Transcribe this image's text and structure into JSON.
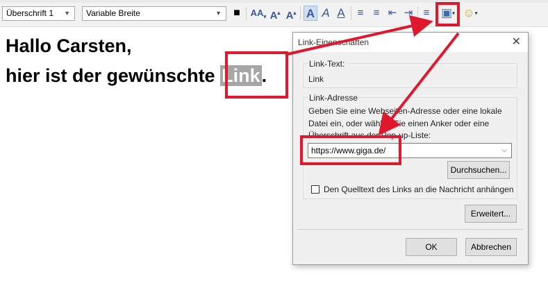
{
  "toolbar": {
    "paragraph_style": "Überschrift 1",
    "font": "Variable Breite",
    "text_color_glyph": "■",
    "smaller_text": "AA",
    "bigger_text": "A",
    "bold_text": "A",
    "italic_text": "A",
    "underline_text": "A",
    "bullets_glyph": "≡",
    "numbering_glyph": "≡",
    "outdent_glyph": "⇤",
    "indent_glyph": "⇥",
    "align_glyph": "≡",
    "insert_glyph": "▣",
    "smiley_glyph": "☺",
    "dropdown_glyph": "▾",
    "accent_color": "#3b6db5"
  },
  "document": {
    "line1": "Hallo Carsten,",
    "line2_prefix": "hier ist der gewünschte ",
    "link_word": "Link",
    "line2_suffix": "."
  },
  "dialog": {
    "title": "Link-Eigenschaften",
    "close_glyph": "✕",
    "link_text_label": "Link-Text:",
    "link_text_value": "Link",
    "link_address_label": "Link-Adresse",
    "help_line1": "Geben Sie eine Webseiten-Adresse oder eine lokale",
    "help_line2": "Datei ein, oder wählen Sie einen Anker oder eine",
    "help_line3": "Überschrift aus der Pop-up-Liste:",
    "url_value": "https://www.giga.de/",
    "browse_button": "Durchsuchen...",
    "attach_source_label": "Den Quelltext des Links an die Nachricht anhängen",
    "attach_source_checked": false,
    "advanced_button": "Erweitert...",
    "ok_button": "OK",
    "cancel_button": "Abbrechen"
  },
  "annotation_color": "#e0182d"
}
